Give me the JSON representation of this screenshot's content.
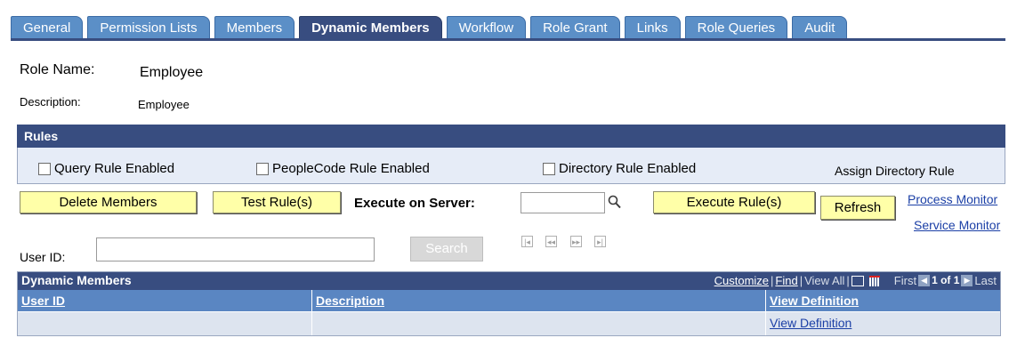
{
  "tabs": [
    "General",
    "Permission Lists",
    "Members",
    "Dynamic Members",
    "Workflow",
    "Role Grant",
    "Links",
    "Role Queries",
    "Audit"
  ],
  "active_tab": "Dynamic Members",
  "role_name_label": "Role Name:",
  "role_name_value": "Employee",
  "description_label": "Description:",
  "description_value": "Employee",
  "rules": {
    "title": "Rules",
    "query_rule": "Query Rule Enabled",
    "peoplecode_rule": "PeopleCode Rule Enabled",
    "directory_rule": "Directory Rule Enabled",
    "assign_directory_rule": "Assign Directory Rule"
  },
  "actions": {
    "delete_members": "Delete Members",
    "test_rules": "Test Rule(s)",
    "execute_on_server_label": "Execute on Server:",
    "execute_on_server_value": "",
    "execute_rules": "Execute Rule(s)",
    "refresh": "Refresh",
    "process_monitor": "Process Monitor",
    "service_monitor": "Service Monitor"
  },
  "search": {
    "user_id_label": "User ID:",
    "user_id_value": "",
    "search_button": "Search"
  },
  "grid": {
    "title": "Dynamic Members",
    "customize": "Customize",
    "find": "Find",
    "view_all": "View All",
    "first": "First",
    "page_info": "1 of 1",
    "last": "Last",
    "columns": [
      "User ID",
      "Description",
      "View Definition"
    ],
    "rows": [
      {
        "user_id": "",
        "description": "",
        "view_definition": "View Definition"
      }
    ]
  },
  "colors": {
    "header_blue": "#384d80",
    "tab_blue": "#5b8fc7",
    "button_yellow": "#ffffa8",
    "link_blue": "#1b3fa6"
  }
}
